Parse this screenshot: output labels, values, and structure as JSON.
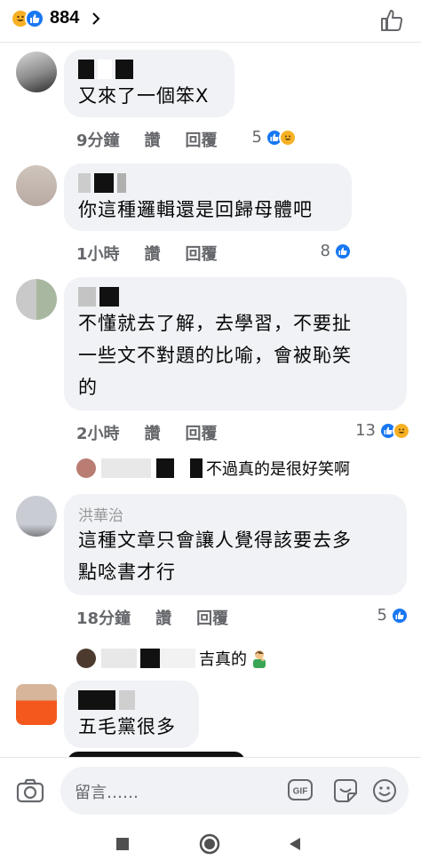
{
  "top": {
    "reaction_count": "884"
  },
  "comments": [
    {
      "text_lines": [
        "又來了一個笨X"
      ],
      "time": "9分鐘",
      "like": "讚",
      "reply": "回覆",
      "reaction_count": "5"
    },
    {
      "text_lines": [
        "你這種邏輯還是回歸母體吧"
      ],
      "time": "1小時",
      "like": "讚",
      "reply": "回覆",
      "reaction_count": "8"
    },
    {
      "text_lines": [
        "不懂就去了解，去學習，不要扯",
        "一些文不對題的比喻，會被恥笑",
        "的"
      ],
      "time": "2小時",
      "like": "讚",
      "reply": "回覆",
      "reaction_count": "13"
    },
    {
      "name_partial": "洪華治",
      "text_lines": [
        "這種文章只會讓人覺得該要去多",
        "點唸書才行"
      ],
      "time": "18分鐘",
      "like": "讚",
      "reply": "回覆",
      "reaction_count": "5"
    },
    {
      "text_lines": [
        "五毛黨很多"
      ]
    }
  ],
  "replies": [
    {
      "text": "不過真的是很好笑啊"
    },
    {
      "text": "吉真的"
    }
  ],
  "composer": {
    "placeholder": "留言……"
  },
  "colors": {
    "like_blue": "#1877f2",
    "haha_yellow": "#f7b125",
    "bubble_bg": "#f0f2f5",
    "meta_gray": "#65676b"
  }
}
